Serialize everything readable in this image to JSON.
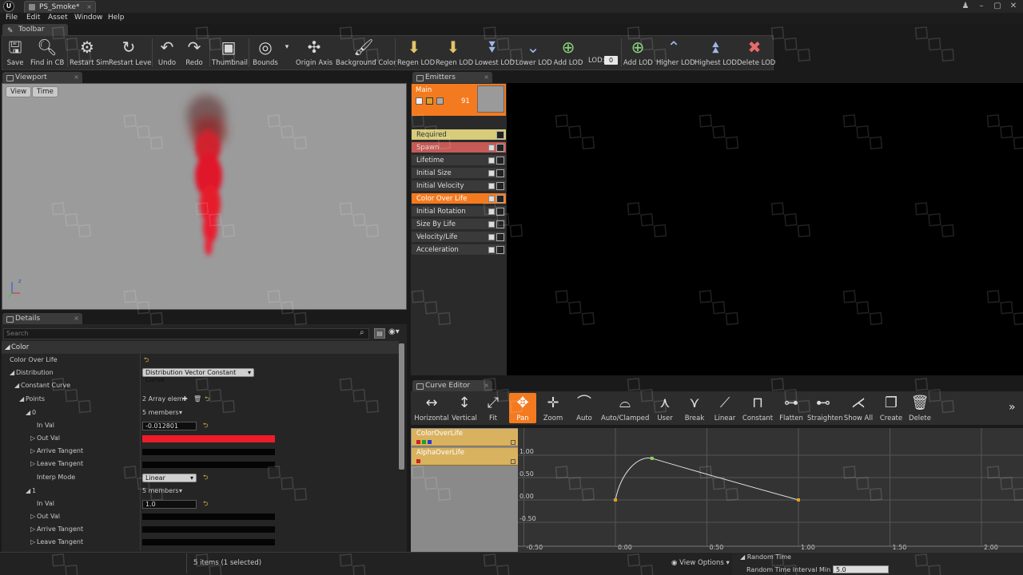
{
  "window": {
    "doc_tab": "PS_Smoke*"
  },
  "menu": [
    "File",
    "Edit",
    "Asset",
    "Window",
    "Help"
  ],
  "toolbar_tab": "Toolbar",
  "toolbar": [
    {
      "label": "Save",
      "icon": "save-icon"
    },
    {
      "label": "Find in CB",
      "icon": "find-icon"
    },
    {
      "label": "Restart Sim",
      "icon": "restart-sim-icon"
    },
    {
      "label": "Restart Level",
      "icon": "restart-level-icon"
    },
    {
      "label": "Undo",
      "icon": "undo-icon"
    },
    {
      "label": "Redo",
      "icon": "redo-icon"
    },
    {
      "label": "Thumbnail",
      "icon": "thumbnail-icon"
    },
    {
      "label": "Bounds",
      "icon": "bounds-icon"
    },
    {
      "label": "Origin Axis",
      "icon": "origin-axis-icon"
    },
    {
      "label": "Background Color",
      "icon": "background-color-icon"
    },
    {
      "label": "Regen LOD",
      "icon": "regen-lod-icon"
    },
    {
      "label": "Regen LOD",
      "icon": "regen-lod-2-icon"
    },
    {
      "label": "Lowest LOD",
      "icon": "lowest-lod-icon"
    },
    {
      "label": "Lower LOD",
      "icon": "lower-lod-icon"
    },
    {
      "label": "Add LOD",
      "icon": "add-lod-icon"
    },
    {
      "label": "Add LOD",
      "icon": "add-lod-2-icon"
    },
    {
      "label": "Higher LOD",
      "icon": "higher-lod-icon"
    },
    {
      "label": "Highest LOD",
      "icon": "highest-lod-icon"
    },
    {
      "label": "Delete LOD",
      "icon": "delete-lod-icon"
    }
  ],
  "lod": {
    "label": "LOD:",
    "value": "0"
  },
  "viewport": {
    "tab": "Viewport",
    "view_btn": "View",
    "time_btn": "Time"
  },
  "details": {
    "tab": "Details",
    "search_placeholder": "Search",
    "category": "Color",
    "rows": {
      "color_over_life": "Color Over Life",
      "distribution": "Distribution",
      "distribution_value": "Distribution Vector Constant Curve",
      "constant_curve": "Constant Curve",
      "points": "Points",
      "points_value": "2 Array elem",
      "p0": "0",
      "p0_members": "5 members",
      "p0_inval_label": "In Val",
      "p0_inval": "-0.012801",
      "p0_outval_label": "Out Val",
      "p0_arrive": "Arrive Tangent",
      "p0_leave": "Leave Tangent",
      "interp_label": "Interp Mode",
      "interp_value": "Linear",
      "p1": "1",
      "p1_members": "5 members",
      "p1_inval_label": "In Val",
      "p1_inval": "1.0",
      "p1_outval_label": "Out Val",
      "p1_arrive": "Arrive Tangent",
      "p1_leave": "Leave Tangent"
    }
  },
  "emitters": {
    "tab": "Emitters",
    "emitter_name": "Main",
    "emitter_count": "91",
    "modules": [
      "Required",
      "Spawn",
      "Lifetime",
      "Initial Size",
      "Initial Velocity",
      "Color Over Life",
      "Initial Rotation",
      "Size By Life",
      "Velocity/Life",
      "Acceleration"
    ],
    "colors": {
      "required": "#d6cc7a",
      "spawn": "#c65a56",
      "selected": "#f47a1f",
      "normal": "#3a3a3a"
    }
  },
  "curve_editor": {
    "tab": "Curve Editor",
    "tools": [
      "Horizontal",
      "Vertical",
      "Fit",
      "Pan",
      "Zoom",
      "Auto",
      "Auto/Clamped",
      "User",
      "Break",
      "Linear",
      "Constant",
      "Flatten",
      "Straighten",
      "Show All",
      "Create",
      "Delete"
    ],
    "tool_icons": [
      "horizontal-fit-icon",
      "vertical-fit-icon",
      "fit-icon",
      "pan-icon",
      "zoom-icon",
      "auto-tangent-icon",
      "auto-clamped-icon",
      "user-tangent-icon",
      "break-tangent-icon",
      "linear-icon",
      "constant-icon",
      "flatten-icon",
      "straighten-icon",
      "show-all-icon",
      "create-icon",
      "delete-icon"
    ],
    "curves": [
      "ColorOverLife",
      "AlphaOverLife"
    ],
    "y_labels": [
      "1.00",
      "0.50",
      "0.00",
      "-0.50"
    ],
    "x_labels": [
      "-0.50",
      "0.00",
      "0.50",
      "1.00",
      "1.50",
      "2.00"
    ],
    "points": [
      [
        0.0,
        0.0
      ],
      [
        0.2,
        0.93
      ],
      [
        1.0,
        0.0
      ]
    ]
  },
  "status": {
    "items": "5 items (1 selected)",
    "view_options": "View Options",
    "random_time": "Random Time",
    "random_time_min": "Random Time Interval Min",
    "random_time_min_value": "5.0"
  }
}
